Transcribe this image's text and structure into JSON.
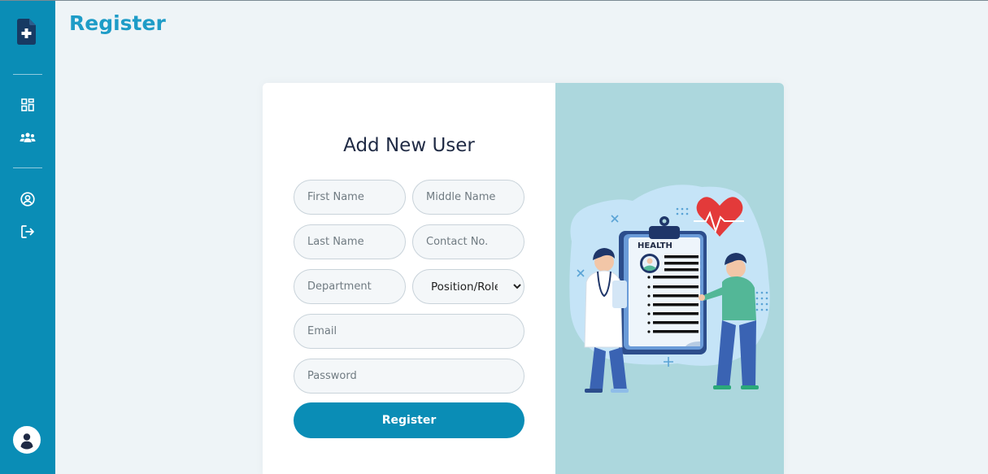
{
  "page": {
    "title": "Register"
  },
  "sidebar": {
    "items": [
      {
        "name": "dashboard",
        "icon": "dashboard-grid-icon"
      },
      {
        "name": "users",
        "icon": "users-group-icon"
      },
      {
        "name": "profile",
        "icon": "user-circle-icon"
      },
      {
        "name": "logout",
        "icon": "logout-icon"
      }
    ]
  },
  "form": {
    "title": "Add New User",
    "first_name_placeholder": "First Name",
    "middle_name_placeholder": "Middle Name",
    "last_name_placeholder": "Last Name",
    "contact_placeholder": "Contact No.",
    "department_placeholder": "Department",
    "position_selected": "Position/Role",
    "email_placeholder": "Email",
    "password_placeholder": "Password",
    "submit_label": "Register"
  },
  "illustration": {
    "clipboard_label": "HEALTH"
  },
  "colors": {
    "primary": "#0a8db6",
    "title": "#1e9cc7",
    "background": "#eef4f7",
    "illustration_bg": "#acd7dd"
  }
}
